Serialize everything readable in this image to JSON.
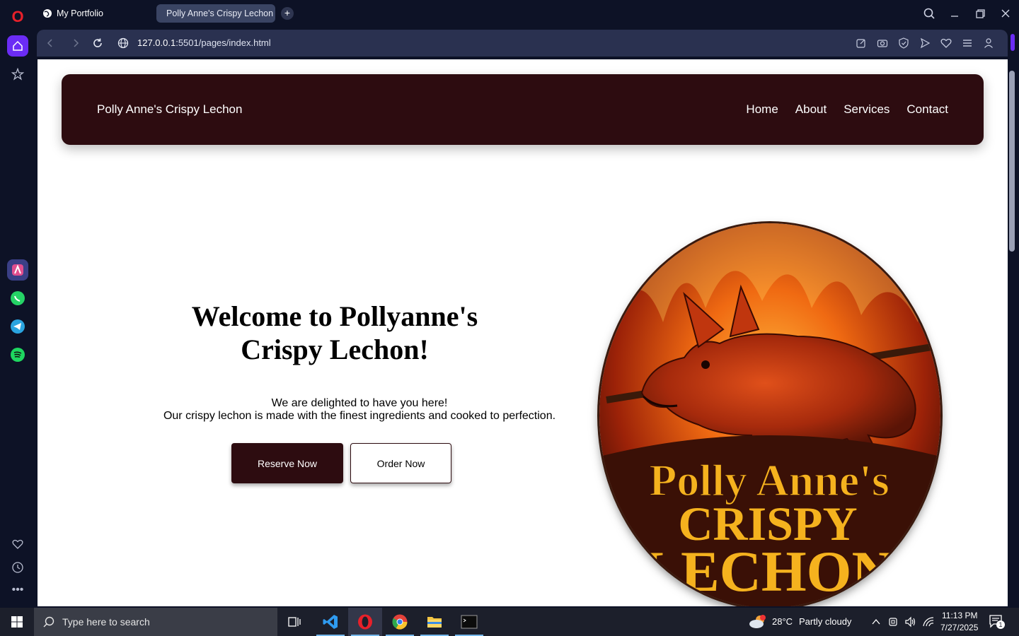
{
  "browser": {
    "tabs": [
      {
        "label": "My Portfolio",
        "active": false
      },
      {
        "label": "Polly Anne's Crispy Lechon",
        "active": true
      }
    ],
    "url_host": "127.0.0.1",
    "url_rest": ":5501/pages/index.html"
  },
  "site": {
    "brand": "Polly Anne's Crispy Lechon",
    "nav": [
      "Home",
      "About",
      "Services",
      "Contact"
    ],
    "hero": {
      "title_line1": "Welcome to Pollyanne's",
      "title_line2": "Crispy Lechon!",
      "sub_line1": "We are delighted to have you here!",
      "sub_line2": "Our crispy lechon is made with the finest ingredients and cooked to perfection.",
      "reserve_label": "Reserve Now",
      "order_label": "Order Now"
    },
    "logo": {
      "line1": "Polly Anne's",
      "line2": "CRISPY",
      "line3": "LECHON"
    },
    "colors": {
      "accent": "#2d0c10",
      "logo_text": "#f5b21e"
    }
  },
  "taskbar": {
    "search_placeholder": "Type here to search",
    "weather_temp": "28°C",
    "weather_desc": "Partly cloudy",
    "time": "11:13 PM",
    "date": "7/27/2025",
    "notification_count": "1"
  }
}
